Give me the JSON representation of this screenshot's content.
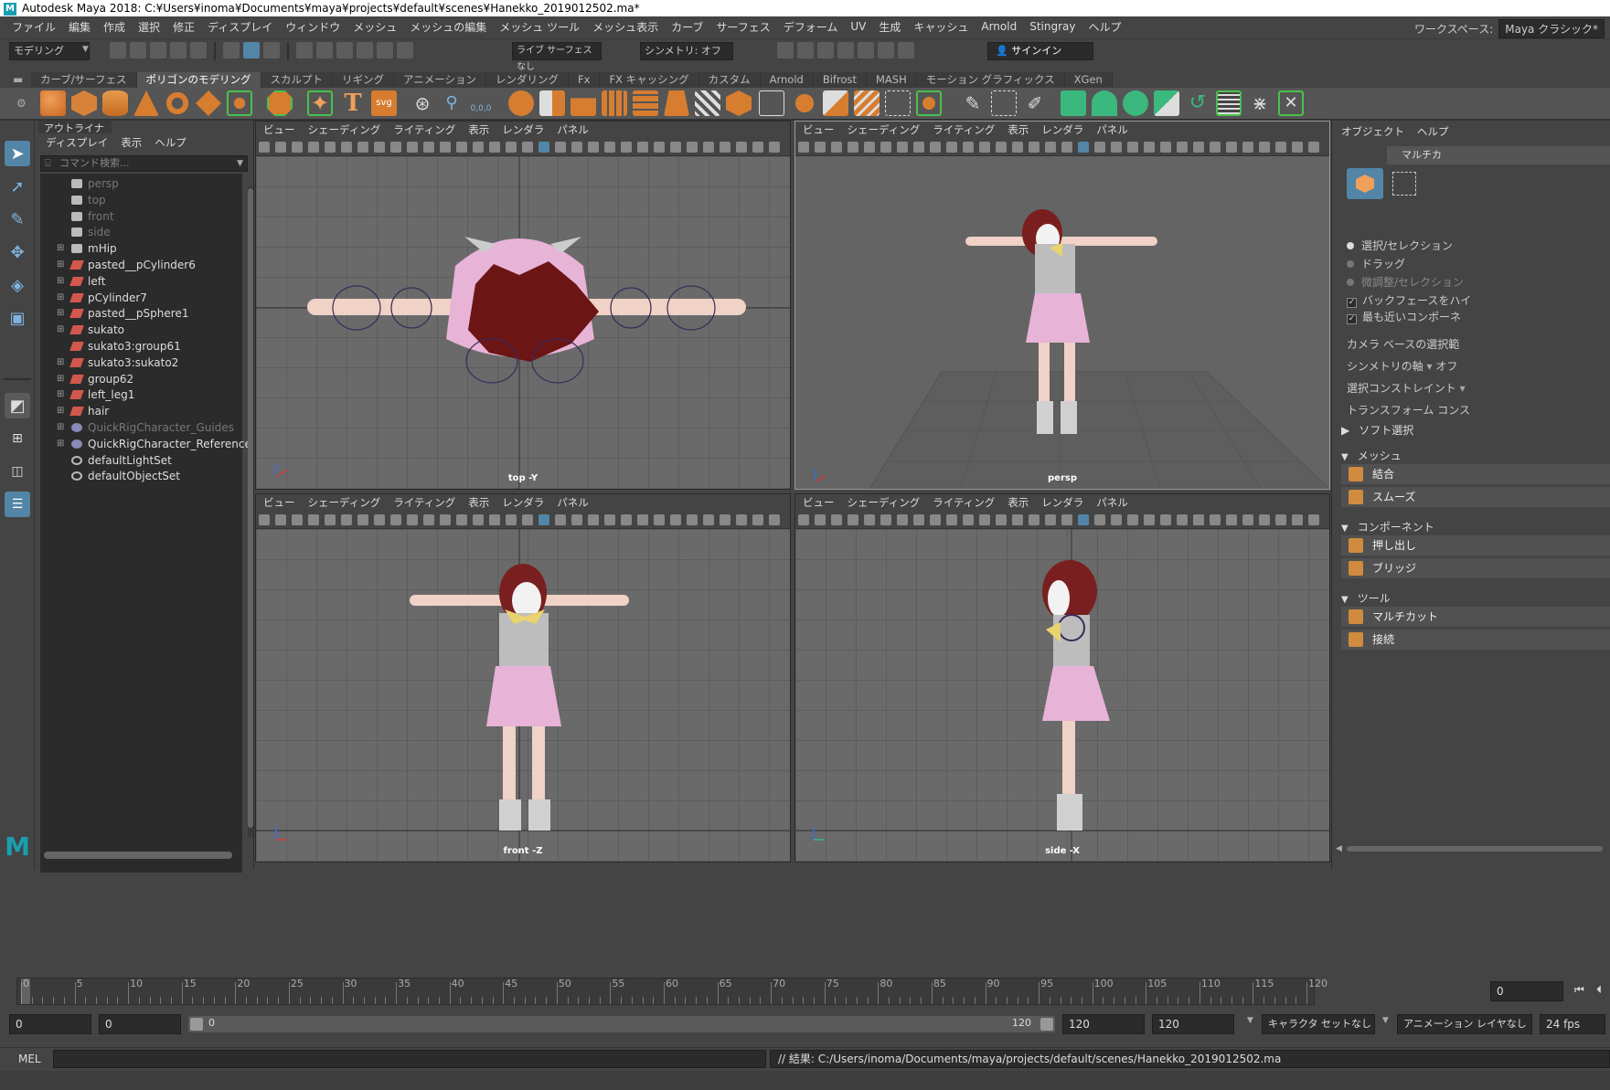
{
  "window": {
    "title": "Autodesk Maya 2018: C:¥Users¥inoma¥Documents¥maya¥projects¥default¥scenes¥Hanekko_2019012502.ma*",
    "logo": "M"
  },
  "menubar": {
    "items": [
      "ファイル",
      "編集",
      "作成",
      "選択",
      "修正",
      "ディスプレイ",
      "ウィンドウ",
      "メッシュ",
      "メッシュの編集",
      "メッシュ ツール",
      "メッシュ表示",
      "カーブ",
      "サーフェス",
      "デフォーム",
      "UV",
      "生成",
      "キャッシュ",
      "Arnold",
      "Stingray",
      "ヘルプ"
    ],
    "workspace_label": "ワークスペース:",
    "workspace_value": "Maya クラシック*"
  },
  "statusline": {
    "mode": "モデリング",
    "live_surface": "ライブ サーフェスなし",
    "symmetry": "シンメトリ: オフ",
    "sign_in": "サインイン"
  },
  "shelf": {
    "tabs": [
      "カーブ/サーフェス",
      "ポリゴンのモデリング",
      "スカルプト",
      "リギング",
      "アニメーション",
      "レンダリング",
      "Fx",
      "FX キャッシング",
      "カスタム",
      "Arnold",
      "Bifrost",
      "MASH",
      "モーション グラフィックス",
      "XGen"
    ],
    "active_tab": "ポリゴンのモデリング",
    "text_icon": "T",
    "svg_icon": "svg",
    "coord_icon": "0,0,0"
  },
  "outliner": {
    "title": "アウトライナ",
    "menu": [
      "ディスプレイ",
      "表示",
      "ヘルプ"
    ],
    "search_placeholder": "コマンド検索...",
    "items": [
      {
        "label": "persp",
        "icon": "camera-icon",
        "dim": true,
        "expandable": false
      },
      {
        "label": "top",
        "icon": "camera-icon",
        "dim": true,
        "expandable": false
      },
      {
        "label": "front",
        "icon": "camera-icon",
        "dim": true,
        "expandable": false
      },
      {
        "label": "side",
        "icon": "camera-icon",
        "dim": true,
        "expandable": false
      },
      {
        "label": "mHip",
        "icon": "camera-icon",
        "dim": false,
        "expandable": true
      },
      {
        "label": "pasted__pCylinder6",
        "icon": "mesh-icon",
        "dim": false,
        "expandable": true
      },
      {
        "label": "left",
        "icon": "mesh-icon",
        "dim": false,
        "expandable": true
      },
      {
        "label": "pCylinder7",
        "icon": "mesh-icon",
        "dim": false,
        "expandable": true
      },
      {
        "label": "pasted__pSphere1",
        "icon": "mesh-icon",
        "dim": false,
        "expandable": true
      },
      {
        "label": "sukato",
        "icon": "mesh-icon",
        "dim": false,
        "expandable": true
      },
      {
        "label": "sukato3:group61",
        "icon": "mesh-icon",
        "dim": false,
        "expandable": false
      },
      {
        "label": "sukato3:sukato2",
        "icon": "mesh-icon",
        "dim": false,
        "expandable": true
      },
      {
        "label": "group62",
        "icon": "mesh-icon",
        "dim": false,
        "expandable": true
      },
      {
        "label": "left_leg1",
        "icon": "mesh-icon",
        "dim": false,
        "expandable": true
      },
      {
        "label": "hair",
        "icon": "mesh-icon",
        "dim": false,
        "expandable": true
      },
      {
        "label": "QuickRigCharacter_Guides",
        "icon": "rig-icon",
        "dim": true,
        "expandable": true
      },
      {
        "label": "QuickRigCharacter_Reference",
        "icon": "rig-icon",
        "dim": false,
        "expandable": true
      },
      {
        "label": "defaultLightSet",
        "icon": "set-icon",
        "dim": false,
        "expandable": false
      },
      {
        "label": "defaultObjectSet",
        "icon": "set-icon",
        "dim": false,
        "expandable": false
      }
    ]
  },
  "viewport_menu": [
    "ビュー",
    "シェーディング",
    "ライティング",
    "表示",
    "レンダラ",
    "パネル"
  ],
  "viewports": {
    "top": {
      "label": "top -Y"
    },
    "persp": {
      "label": "persp"
    },
    "front": {
      "label": "front -Z"
    },
    "side": {
      "label": "side -X"
    }
  },
  "right_panel": {
    "menu": [
      "オブジェクト",
      "ヘルプ"
    ],
    "multicut_tab": "マルチカ",
    "options": [
      "選択/セレクション",
      "ドラッグ",
      "微調整/セレクション",
      "バックフェースをハイ",
      "最も近いコンポーネ",
      "カメラ ベースの選択範",
      "シンメトリの軸",
      "選択コンストレイント",
      "トランスフォーム コンス"
    ],
    "symmetry_value": "オフ",
    "soft_select": "ソフト選択",
    "sections": {
      "mesh": {
        "title": "メッシュ",
        "buttons": [
          "結合",
          "スムーズ"
        ]
      },
      "component": {
        "title": "コンポーネント",
        "buttons": [
          "押し出し",
          "ブリッジ"
        ]
      },
      "tools": {
        "title": "ツール",
        "buttons": [
          "マルチカット",
          "接続"
        ]
      }
    }
  },
  "timeslider": {
    "ticks": [
      "0",
      "5",
      "10",
      "15",
      "20",
      "25",
      "30",
      "35",
      "40",
      "45",
      "50",
      "55",
      "60",
      "65",
      "70",
      "75",
      "80",
      "85",
      "90",
      "95",
      "100",
      "105",
      "110",
      "115",
      "120"
    ],
    "current_frame": "0"
  },
  "range": {
    "start": "0",
    "playback_start": "0",
    "slider_start": "0",
    "slider_end": "120",
    "playback_end": "120",
    "end": "120",
    "character_set": "キャラクタ セットなし",
    "anim_layer": "アニメーション レイヤなし",
    "fps": "24 fps"
  },
  "cmdline": {
    "lang": "MEL",
    "result": "// 結果: C:/Users/inoma/Documents/maya/projects/default/scenes/Hanekko_2019012502.ma"
  },
  "colors": {
    "accent": "#5285a6",
    "maya_logo": "#1a9fb0",
    "mesh_icon": "#d4574e",
    "skin": "#f0d2c6",
    "pink": "#e7b3d7",
    "hair": "#7a1f1f",
    "bow": "#e8d36e"
  }
}
